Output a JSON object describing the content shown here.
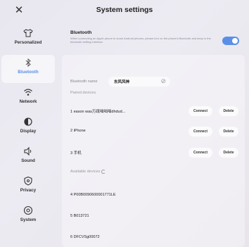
{
  "header": {
    "close_icon": "close-icon",
    "title": "System settings"
  },
  "sidebar": {
    "items": [
      {
        "label": "Personalized",
        "icon": "tshirt-icon",
        "active": false
      },
      {
        "label": "Bluetooth",
        "icon": "bluetooth-icon",
        "active": true
      },
      {
        "label": "Network",
        "icon": "wifi-icon",
        "active": false
      },
      {
        "label": "Display",
        "icon": "display-icon",
        "active": false
      },
      {
        "label": "Sound",
        "icon": "speaker-icon",
        "active": false
      },
      {
        "label": "Privacy",
        "icon": "shield-icon",
        "active": false
      },
      {
        "label": "System",
        "icon": "system-icon",
        "active": false
      }
    ]
  },
  "bluetooth": {
    "title": "Bluetooth",
    "description": "When connecting an Apple phone to some Android phones, please turn on the phone's Bluetooth and keep in the bluetooth setting interface.",
    "enabled": true,
    "name_label": "Bluetooth name",
    "name_value": "东风风神",
    "paired_label": "Paired devices",
    "available_label": "Available devices"
  },
  "paired_devices": [
    {
      "name": "1 eason was万疏咄咄咄dhdud...",
      "connect": "Connect",
      "delete": "Delete"
    },
    {
      "name": "2 iPhone",
      "connect": "Connect",
      "delete": "Delete"
    },
    {
      "name": "3 手机",
      "connect": "Connect",
      "delete": "Delete"
    }
  ],
  "available_devices": [
    {
      "name": "4 P00B0090600001771LE"
    },
    {
      "name": "5 B013721"
    },
    {
      "name": "6 DFCVSg00072"
    }
  ],
  "colors": {
    "accent": "#5a8fe8"
  }
}
